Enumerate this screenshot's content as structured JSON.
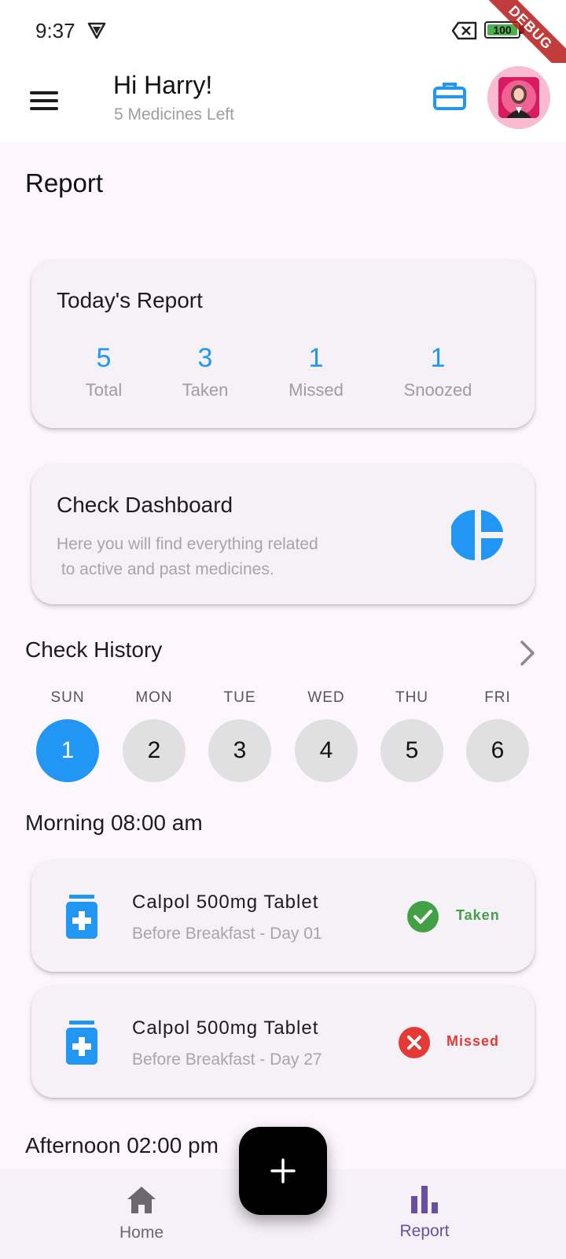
{
  "status_bar": {
    "time": "9:37",
    "battery": "100",
    "debug_label": "DEBUG"
  },
  "header": {
    "greeting": "Hi Harry!",
    "subtitle": "5 Medicines Left"
  },
  "page": {
    "title": "Report"
  },
  "todays_report": {
    "title": "Today's Report",
    "stats": [
      {
        "value": "5",
        "label": "Total"
      },
      {
        "value": "3",
        "label": "Taken"
      },
      {
        "value": "1",
        "label": "Missed"
      },
      {
        "value": "1",
        "label": "Snoozed"
      }
    ]
  },
  "dashboard": {
    "title": "Check Dashboard",
    "description": "Here you will find everything related\n to active and past medicines."
  },
  "history": {
    "title": "Check History",
    "days": [
      {
        "label": "SUN",
        "num": "1"
      },
      {
        "label": "MON",
        "num": "2"
      },
      {
        "label": "TUE",
        "num": "3"
      },
      {
        "label": "WED",
        "num": "4"
      },
      {
        "label": "THU",
        "num": "5"
      },
      {
        "label": "FRI",
        "num": "6"
      }
    ]
  },
  "morning": {
    "title": "Morning 08:00 am",
    "meds": [
      {
        "name": "Calpol 500mg Tablet",
        "detail": "Before Breakfast - Day 01",
        "status": "Taken"
      },
      {
        "name": "Calpol 500mg Tablet",
        "detail": "Before Breakfast - Day 27",
        "status": "Missed"
      }
    ]
  },
  "afternoon": {
    "title": "Afternoon 02:00 pm"
  },
  "nav": {
    "home": "Home",
    "report": "Report"
  },
  "colors": {
    "accent": "#2196f3",
    "taken": "#43a047",
    "missed": "#e53935",
    "nav_active": "#6750a4"
  }
}
